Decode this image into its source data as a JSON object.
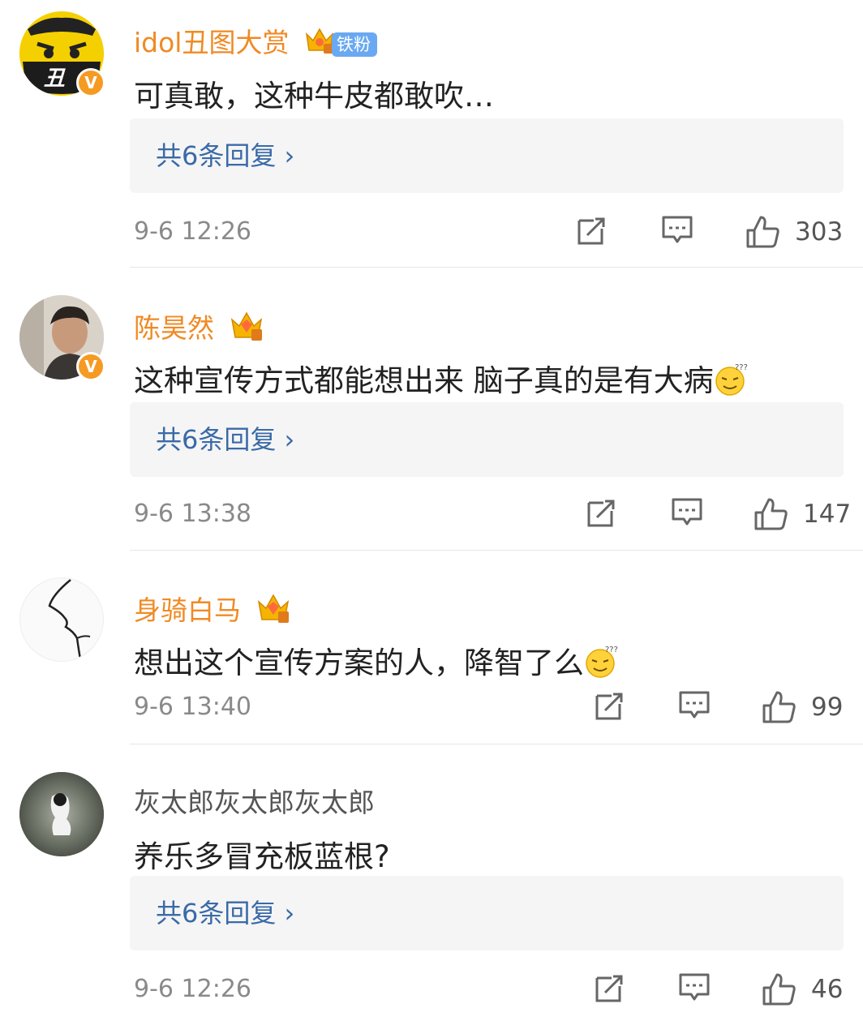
{
  "comments": [
    {
      "username": "idol丑图大赏",
      "fan_badge": "铁粉",
      "text": "可真敢，这种牛皮都敢吹…",
      "replies_label": "共6条回复 ›",
      "time": "9-6 12:26",
      "likes": "303",
      "verified": "V",
      "avatar_char": "丑"
    },
    {
      "username": "陈昊然",
      "text": "这种宣传方式都能想出来 脑子真的是有大病",
      "replies_label": "共6条回复 ›",
      "time": "9-6 13:38",
      "likes": "147",
      "verified": "V"
    },
    {
      "username": "身骑白马",
      "text": "想出这个宣传方案的人，降智了么",
      "time": "9-6 13:40",
      "likes": "99"
    },
    {
      "username": "灰太郎灰太郎灰太郎",
      "text": "养乐多冒充板蓝根?",
      "replies_label": "共6条回复 ›",
      "time": "9-6 12:26",
      "likes": "46"
    }
  ],
  "colors": {
    "username_vip": "#f08a24",
    "reply_link": "#3a6aa8",
    "verified_badge": "#f59a23",
    "fan_badge": "#6aa9f1"
  }
}
